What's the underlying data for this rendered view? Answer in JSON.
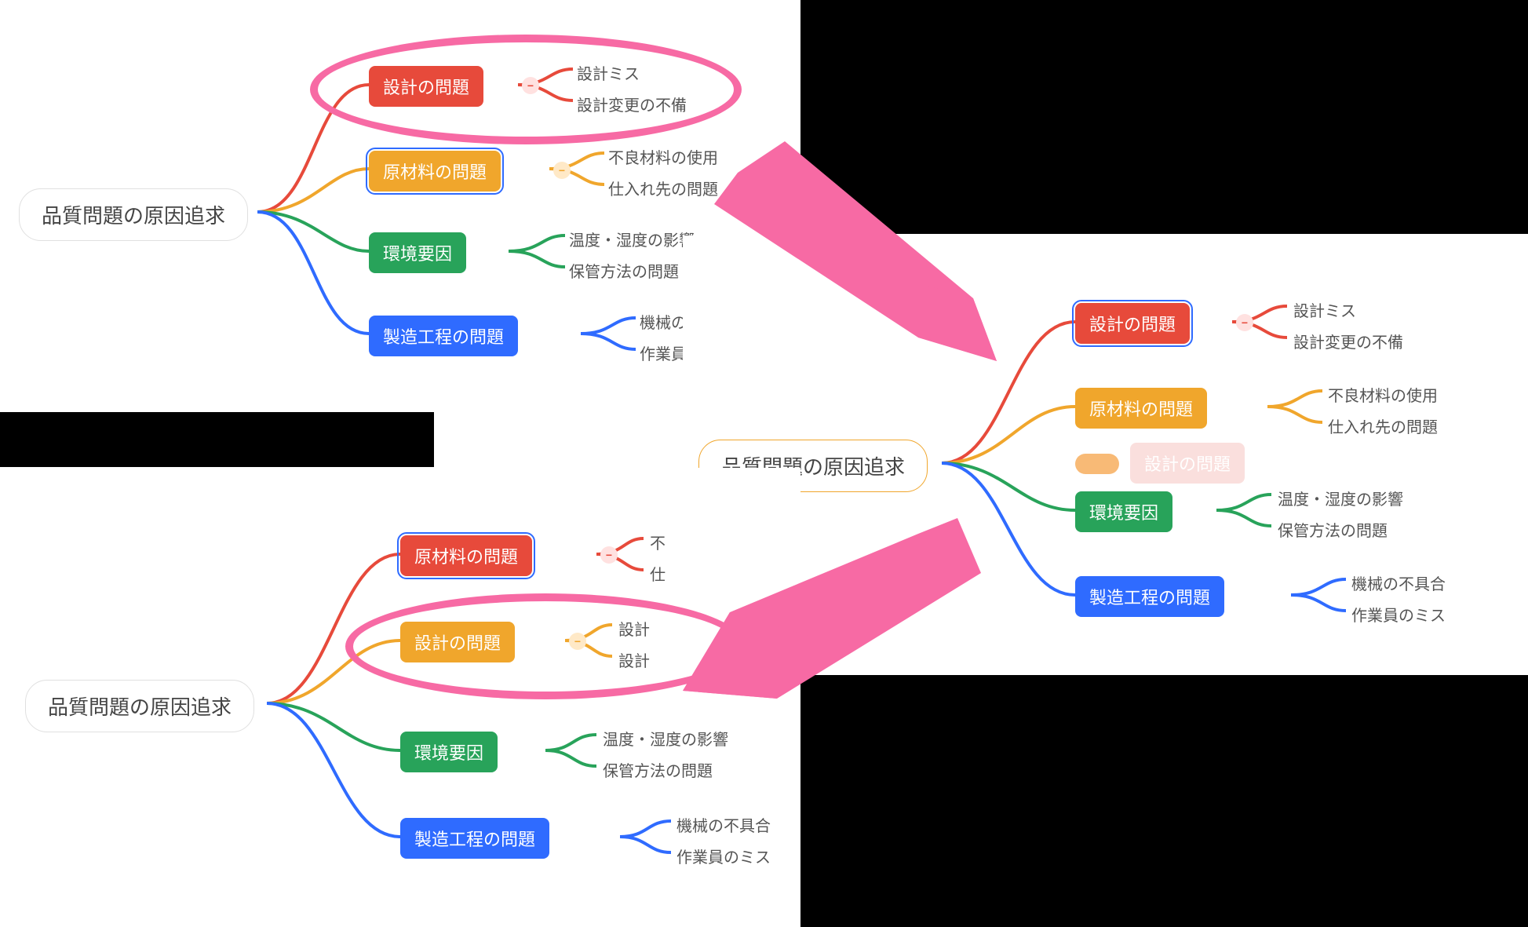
{
  "colors": {
    "red": "#e74a3b",
    "orange": "#f0a62c",
    "green": "#28a35a",
    "blue": "#2f6bff",
    "gray": "#555555",
    "pink": "#f76aa4"
  },
  "panel_a": {
    "root": "品質問題の原因追求",
    "branches": [
      {
        "id": "design",
        "label": "設計の問題",
        "color": "red",
        "leaves": [
          "設計ミス",
          "設計変更の不備"
        ]
      },
      {
        "id": "material",
        "label": "原材料の問題",
        "color": "orange",
        "leaves": [
          "不良材料の使用",
          "仕入れ先の問題"
        ],
        "selected": true
      },
      {
        "id": "env",
        "label": "環境要因",
        "color": "green",
        "leaves": [
          "温度・湿度の影響",
          "保管方法の問題"
        ]
      },
      {
        "id": "process",
        "label": "製造工程の問題",
        "color": "blue",
        "leaves": [
          "機械の",
          "作業員"
        ]
      }
    ],
    "annotation_circled_branch": "design"
  },
  "panel_b": {
    "root": "品質問題の原因追求",
    "branches": [
      {
        "id": "design",
        "label": "設計の問題",
        "color": "red",
        "leaves": [
          "設計ミス",
          "設計変更の不備"
        ],
        "selected": true
      },
      {
        "id": "material",
        "label": "原材料の問題",
        "color": "orange",
        "leaves": [
          "不良材料の使用",
          "仕入れ先の問題"
        ]
      },
      {
        "id": "env",
        "label": "環境要因",
        "color": "green",
        "leaves": [
          "温度・湿度の影響",
          "保管方法の問題"
        ]
      },
      {
        "id": "process",
        "label": "製造工程の問題",
        "color": "blue",
        "leaves": [
          "機械の不具合",
          "作業員のミス"
        ]
      }
    ],
    "drag_ghost_label": "設計の問題"
  },
  "panel_c": {
    "root": "品質問題の原因追求",
    "branches": [
      {
        "id": "material",
        "label": "原材料の問題",
        "color": "red",
        "leaves": [
          "不",
          "仕"
        ],
        "selected": true
      },
      {
        "id": "design",
        "label": "設計の問題",
        "color": "orange",
        "leaves": [
          "設計",
          "設計"
        ]
      },
      {
        "id": "env",
        "label": "環境要因",
        "color": "green",
        "leaves": [
          "温度・湿度の影響",
          "保管方法の問題"
        ]
      },
      {
        "id": "process",
        "label": "製造工程の問題",
        "color": "blue",
        "leaves": [
          "機械の不具合",
          "作業員のミス"
        ]
      }
    ],
    "annotation_circled_branch": "design"
  },
  "toggle_glyph": "−"
}
